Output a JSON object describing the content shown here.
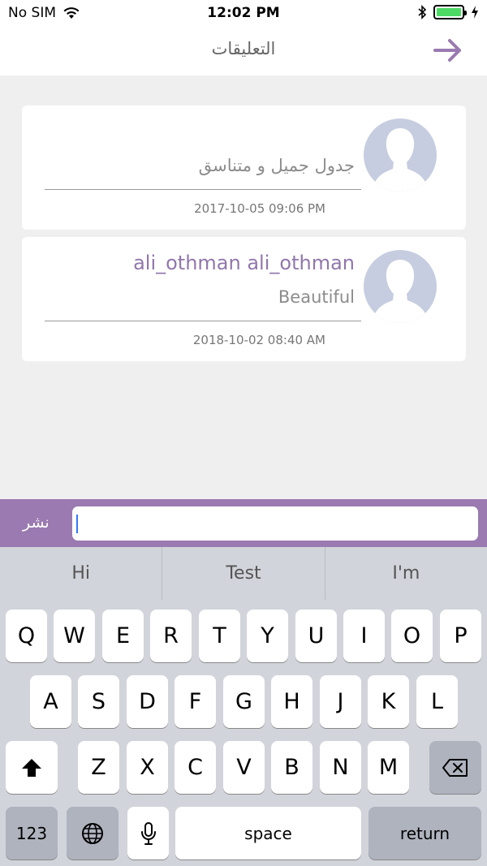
{
  "status_bar": {
    "carrier": "No SIM",
    "time": "12:02 PM",
    "battery_level": 1.0
  },
  "nav": {
    "title": "التعليقات"
  },
  "comments": [
    {
      "author": "",
      "text": "جدول جميل و متناسق",
      "date": "2017-10-05  09:06 PM"
    },
    {
      "author": "ali_othman ali_othman",
      "text": "Beautiful",
      "date": "2018-10-02  08:40 AM"
    }
  ],
  "composer": {
    "post_label": "نشر",
    "input_value": ""
  },
  "suggestions": [
    "Hi",
    "Test",
    "I'm"
  ],
  "keyboard": {
    "row1": [
      "Q",
      "W",
      "E",
      "R",
      "T",
      "Y",
      "U",
      "I",
      "O",
      "P"
    ],
    "row2": [
      "A",
      "S",
      "D",
      "F",
      "G",
      "H",
      "J",
      "K",
      "L"
    ],
    "row3": [
      "Z",
      "X",
      "C",
      "V",
      "B",
      "N",
      "M"
    ],
    "number_label": "123",
    "space_label": "space",
    "return_label": "return"
  },
  "colors": {
    "accent": "#9a7ab0",
    "author": "#9177ac",
    "avatar": "#c6cde0",
    "cursor": "#3478f6"
  }
}
